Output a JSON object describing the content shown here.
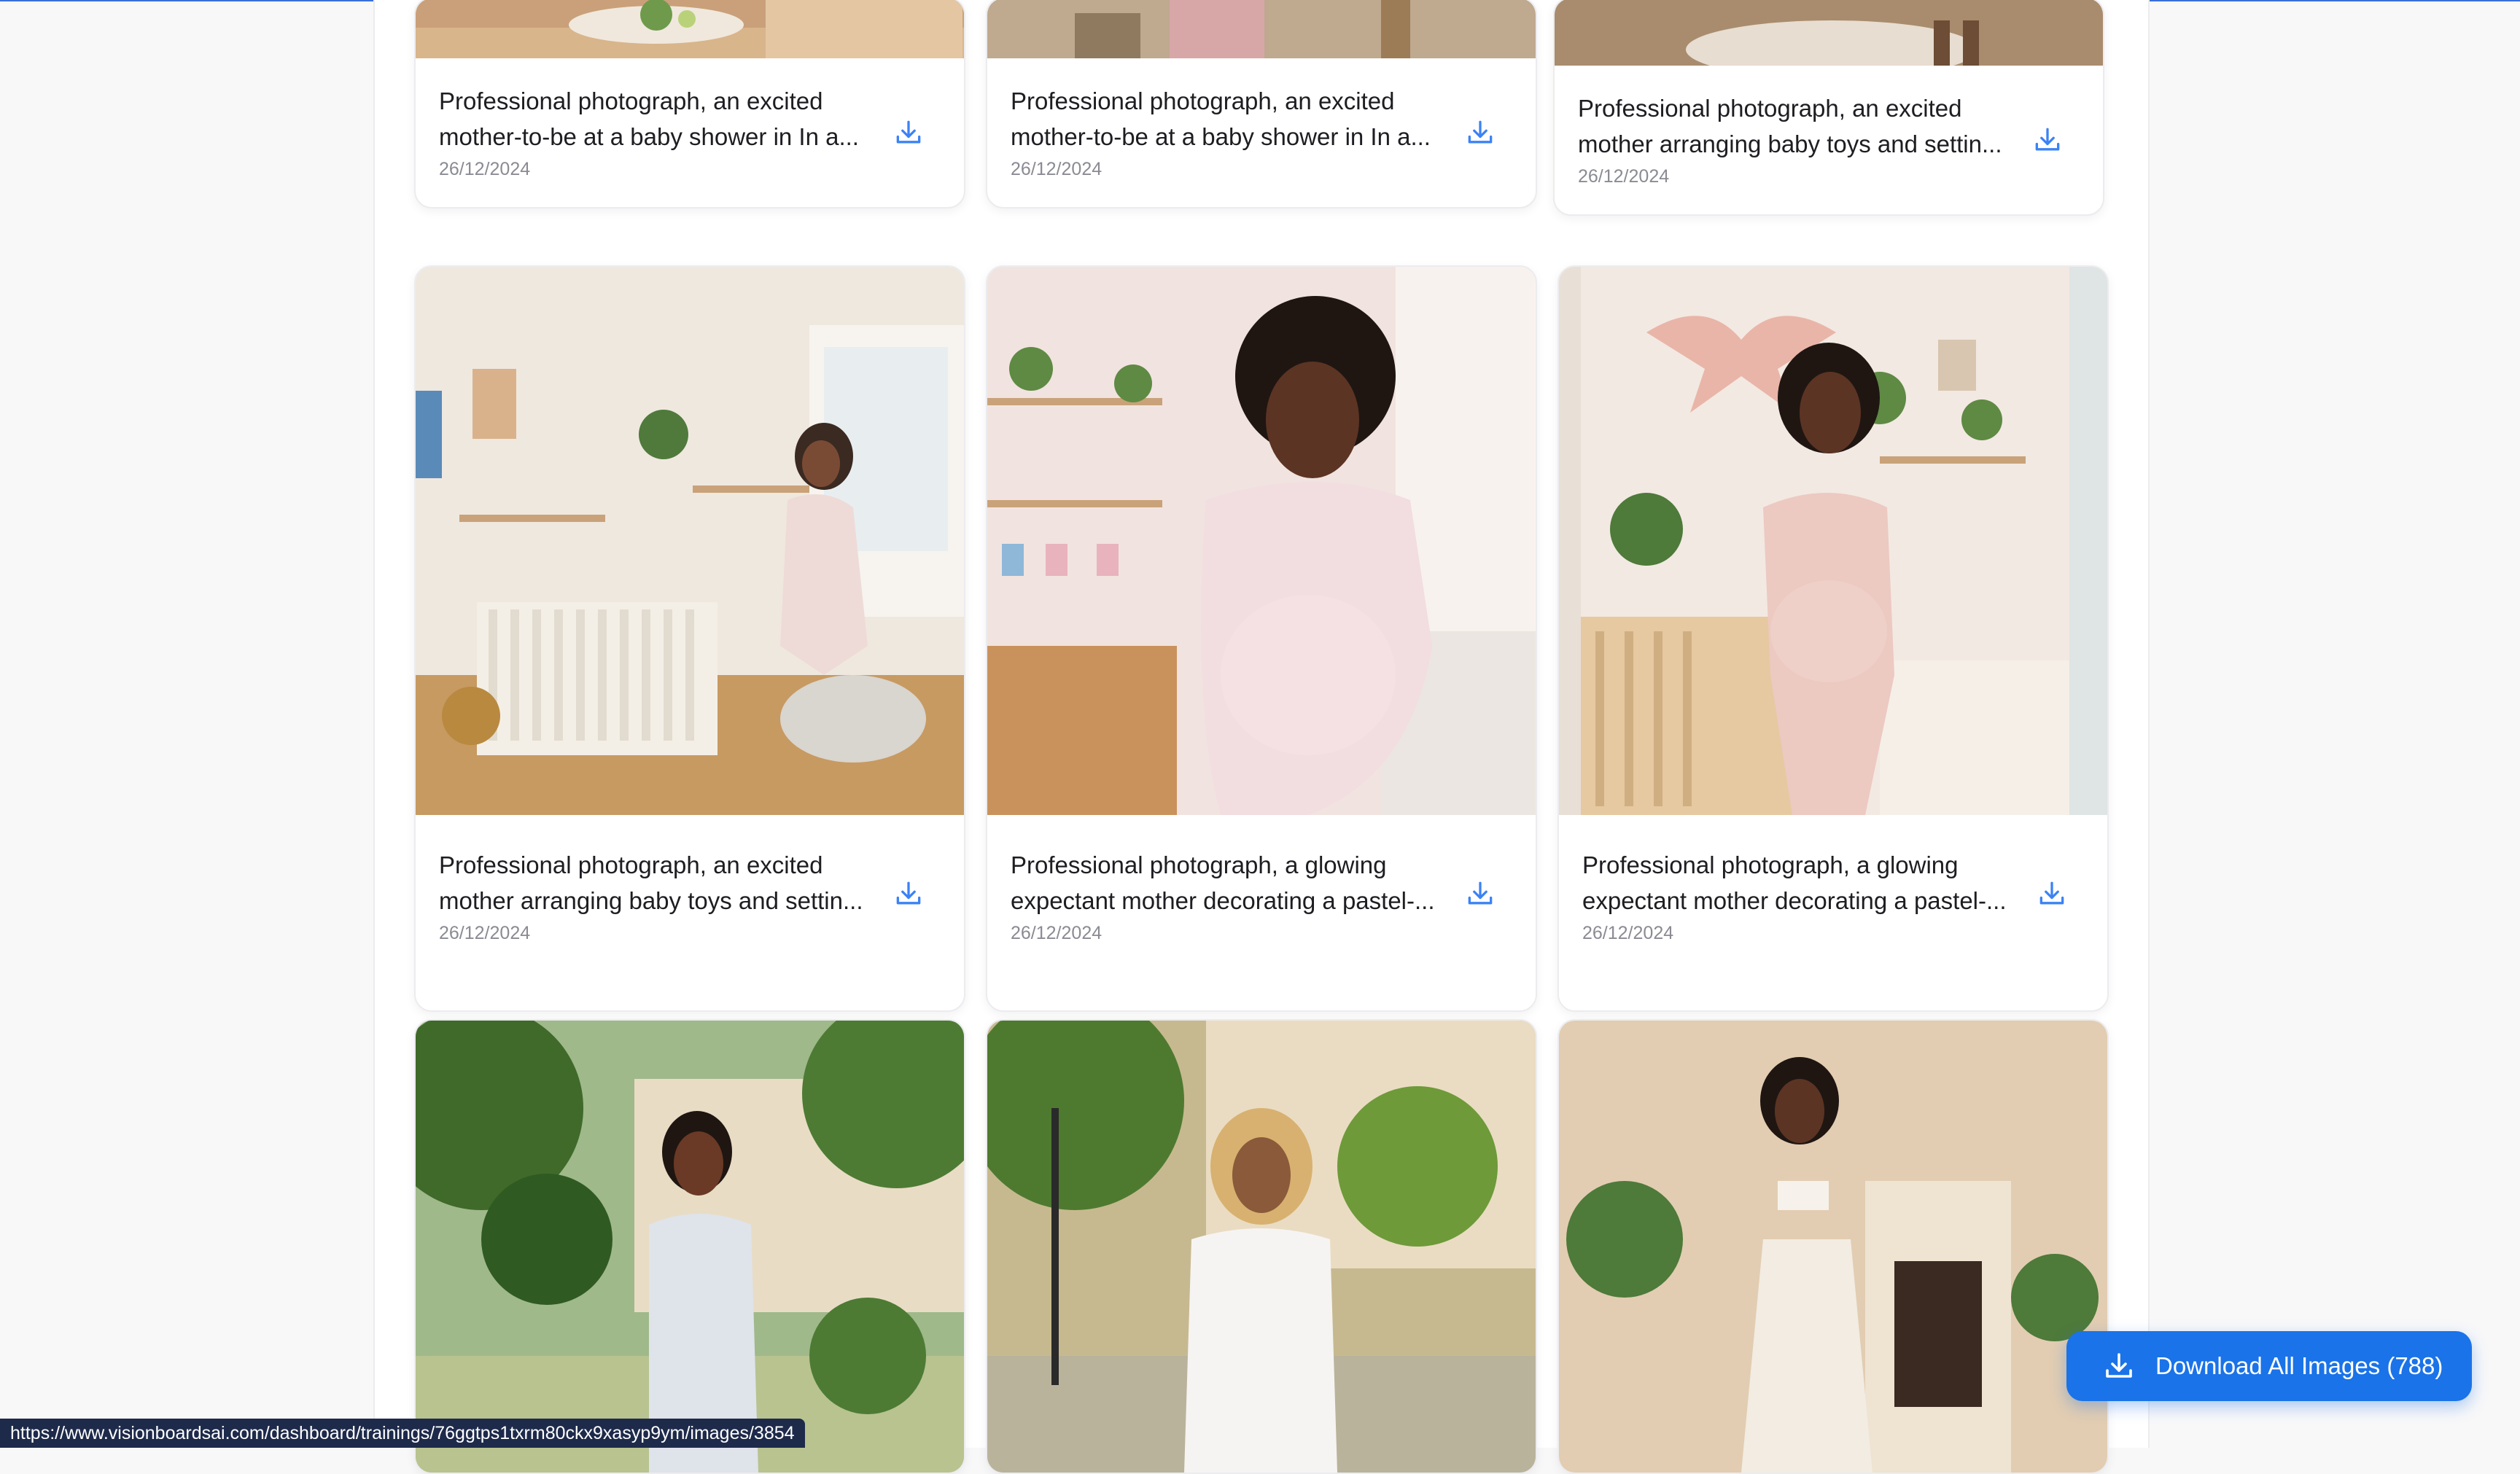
{
  "top_row": [
    {
      "title": "Professional photograph, an excited mother-to-be at a baby shower in In a...",
      "date": "26/12/2024"
    },
    {
      "title": "Professional photograph, an excited mother-to-be at a baby shower in In a...",
      "date": "26/12/2024"
    },
    {
      "title": "Professional photograph, an excited mother arranging baby toys and settin...",
      "date": "26/12/2024"
    }
  ],
  "middle_row": [
    {
      "title": "Professional photograph, an excited mother arranging baby toys and settin...",
      "date": "26/12/2024"
    },
    {
      "title": "Professional photograph, a glowing expectant mother decorating a pastel-...",
      "date": "26/12/2024"
    },
    {
      "title": "Professional photograph, a glowing expectant mother decorating a pastel-...",
      "date": "26/12/2024"
    }
  ],
  "bottom_row": [
    {
      "title": "",
      "date": ""
    },
    {
      "title": "",
      "date": ""
    },
    {
      "title": "",
      "date": ""
    }
  ],
  "download_all": {
    "label": "Download All Images (788)"
  },
  "status_bar": {
    "url": "https://www.visionboardsai.com/dashboard/trainings/76ggtps1txrm80ckx9xasyp9ym/images/3854"
  },
  "colors": {
    "accent": "#1a73e8",
    "download_icon": "#3b82f6"
  },
  "icons": {
    "download": "download-icon"
  }
}
